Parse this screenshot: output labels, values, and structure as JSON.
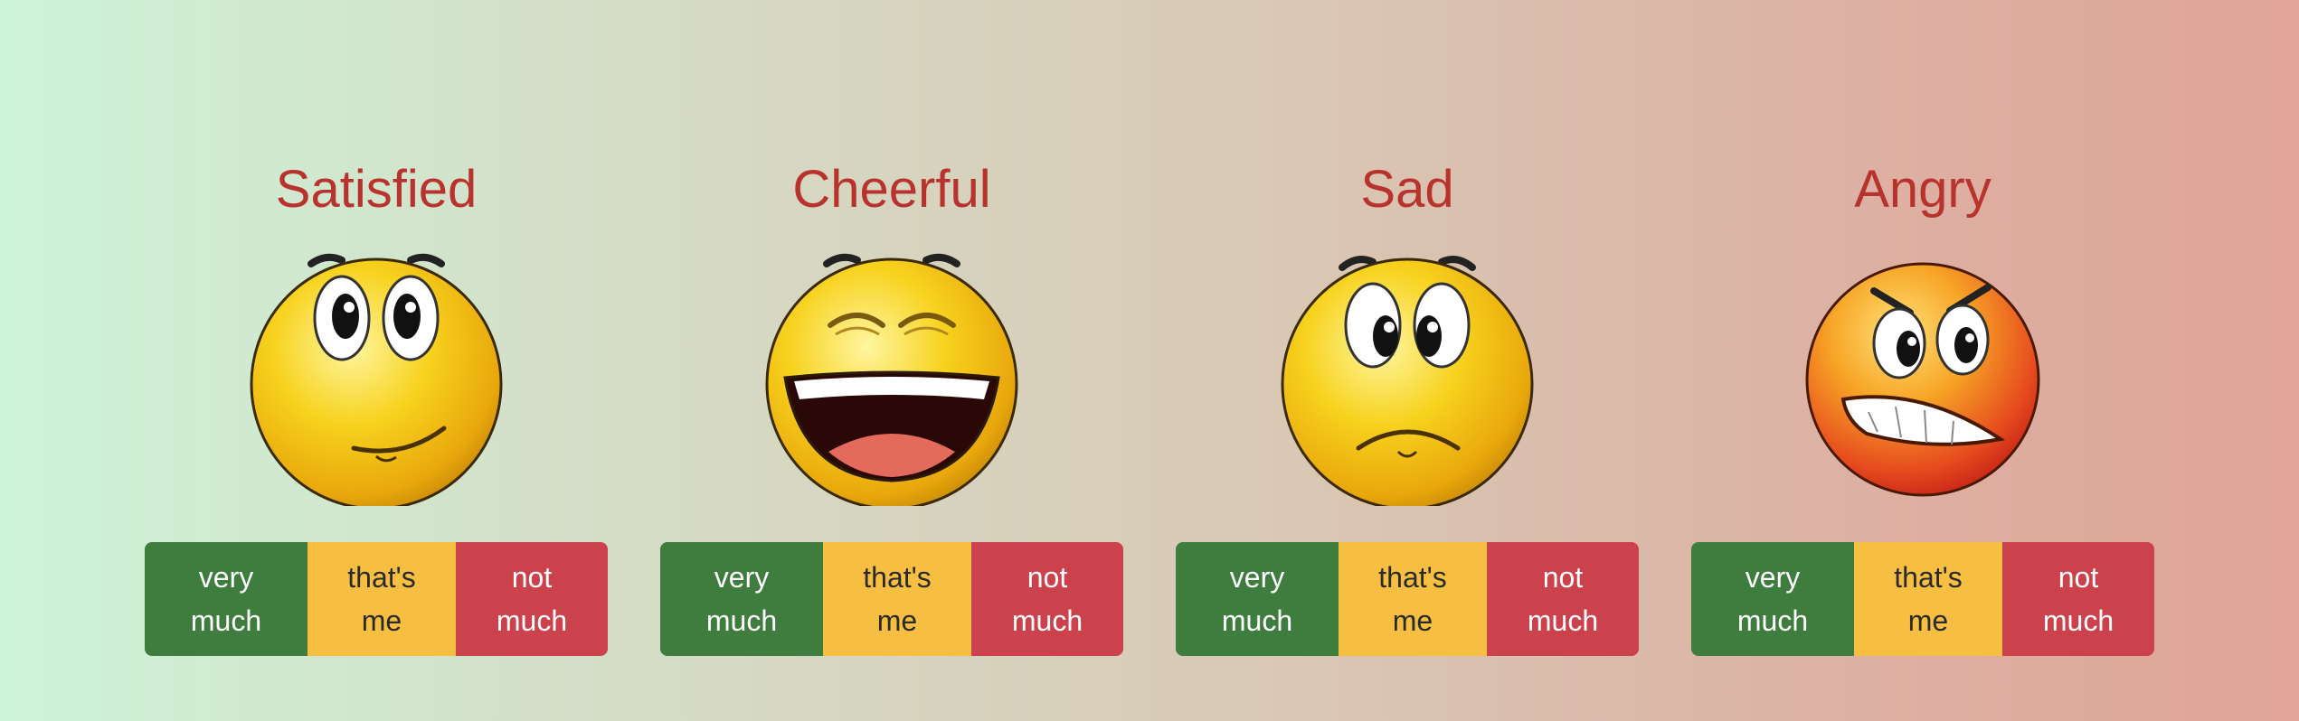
{
  "colors": {
    "title": "#b8322e",
    "very_much": "#3f7d3f",
    "thats_me": "#f6bf42",
    "not_much": "#cc424c"
  },
  "cards": [
    {
      "title": "Satisfied",
      "face_icon": "satisfied-face-icon",
      "options": {
        "very": "very\nmuch",
        "me": "that's\nme",
        "not": "not\nmuch"
      }
    },
    {
      "title": "Cheerful",
      "face_icon": "cheerful-face-icon",
      "options": {
        "very": "very\nmuch",
        "me": "that's\nme",
        "not": "not\nmuch"
      }
    },
    {
      "title": "Sad",
      "face_icon": "sad-face-icon",
      "options": {
        "very": "very\nmuch",
        "me": "that's\nme",
        "not": "not\nmuch"
      }
    },
    {
      "title": "Angry",
      "face_icon": "angry-face-icon",
      "options": {
        "very": "very\nmuch",
        "me": "that's\nme",
        "not": "not\nmuch"
      }
    }
  ]
}
